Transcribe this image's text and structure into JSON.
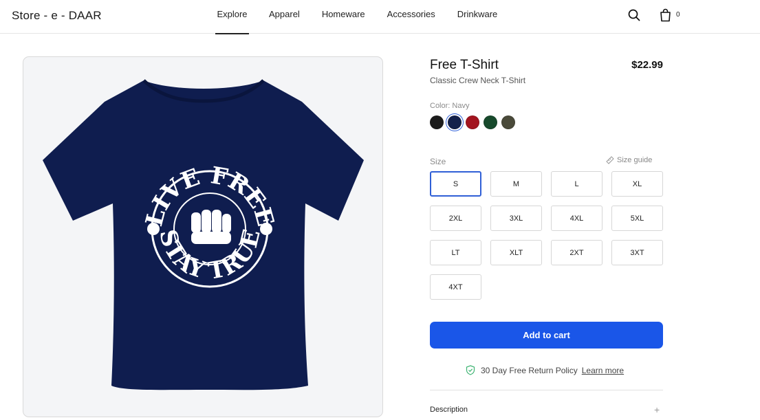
{
  "header": {
    "brand": "Store - e - DAAR",
    "nav": [
      "Explore",
      "Apparel",
      "Homeware",
      "Accessories",
      "Drinkware"
    ],
    "active_nav": "Explore",
    "cart_count": "0",
    "icons": [
      "search-icon",
      "shopping-bag-icon"
    ]
  },
  "product": {
    "title": "Free T-Shirt",
    "price": "$22.99",
    "subtitle": "Classic Crew Neck T-Shirt",
    "image": {
      "shirt_color": "#0f1d4f",
      "graphic_top_text": "LIVE FREE",
      "graphic_bottom_text": "STAY TRUE"
    },
    "color_label": "Color: Navy",
    "colors": [
      {
        "name": "Black",
        "hex": "#1c1c1c"
      },
      {
        "name": "Navy",
        "hex": "#13204a",
        "selected": true
      },
      {
        "name": "Red",
        "hex": "#a3141f"
      },
      {
        "name": "Forest Green",
        "hex": "#174a2c"
      },
      {
        "name": "Olive",
        "hex": "#4a4a3a"
      }
    ],
    "size_label": "Size",
    "size_guide": "Size guide",
    "sizes": [
      "S",
      "M",
      "L",
      "XL",
      "2XL",
      "3XL",
      "4XL",
      "5XL",
      "LT",
      "XLT",
      "2XT",
      "3XT",
      "4XT"
    ],
    "selected_size": "S",
    "add_to_cart": "Add to cart",
    "policy_text": "30 Day Free Return Policy",
    "learn_more": "Learn more",
    "description_label": "Description"
  },
  "colors": {
    "accent": "#1a56e8",
    "selected_border": "#2f5fd6",
    "policy_icon": "#3cb371"
  }
}
